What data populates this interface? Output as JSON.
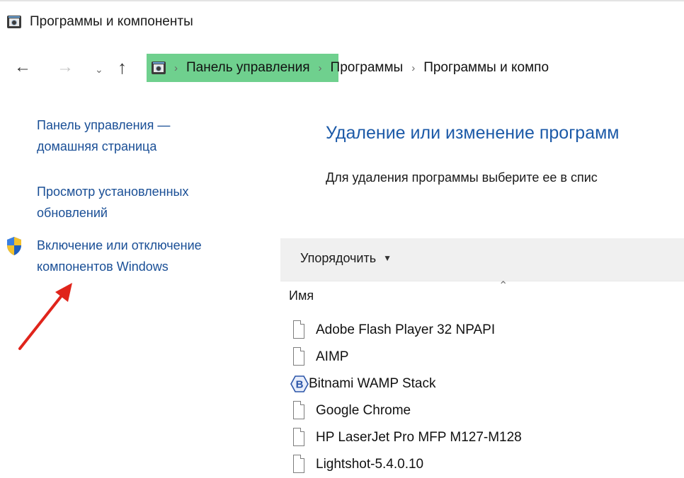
{
  "window": {
    "title": "Программы и компоненты"
  },
  "address": {
    "segments": [
      "Панель управления",
      "Программы",
      "Программы и компо"
    ]
  },
  "sidebar": {
    "home_link": "Панель управления — домашняя страница",
    "updates_link": "Просмотр установленных обновлений",
    "features_link": "Включение или отключение компонентов Windows"
  },
  "main": {
    "heading": "Удаление или изменение программ",
    "description": "Для удаления программы выберите ее в спис",
    "toolbar": {
      "sort_label": "Упорядочить"
    },
    "columns": {
      "name": "Имя"
    },
    "programs": [
      {
        "name": "Adobe Flash Player 32 NPAPI",
        "icon": "generic-file-icon"
      },
      {
        "name": "AIMP",
        "icon": "generic-file-icon"
      },
      {
        "name": "Bitnami WAMP Stack",
        "icon": "bitnami-icon"
      },
      {
        "name": "Google Chrome",
        "icon": "generic-file-icon"
      },
      {
        "name": "HP LaserJet Pro MFP M127-M128",
        "icon": "generic-file-icon"
      },
      {
        "name": "Lightshot-5.4.0.10",
        "icon": "generic-file-icon"
      }
    ]
  },
  "colors": {
    "link": "#1a4f96",
    "heading": "#1c5aa8",
    "address_highlight": "#6fd08e",
    "annotation_arrow": "#e0241b"
  }
}
